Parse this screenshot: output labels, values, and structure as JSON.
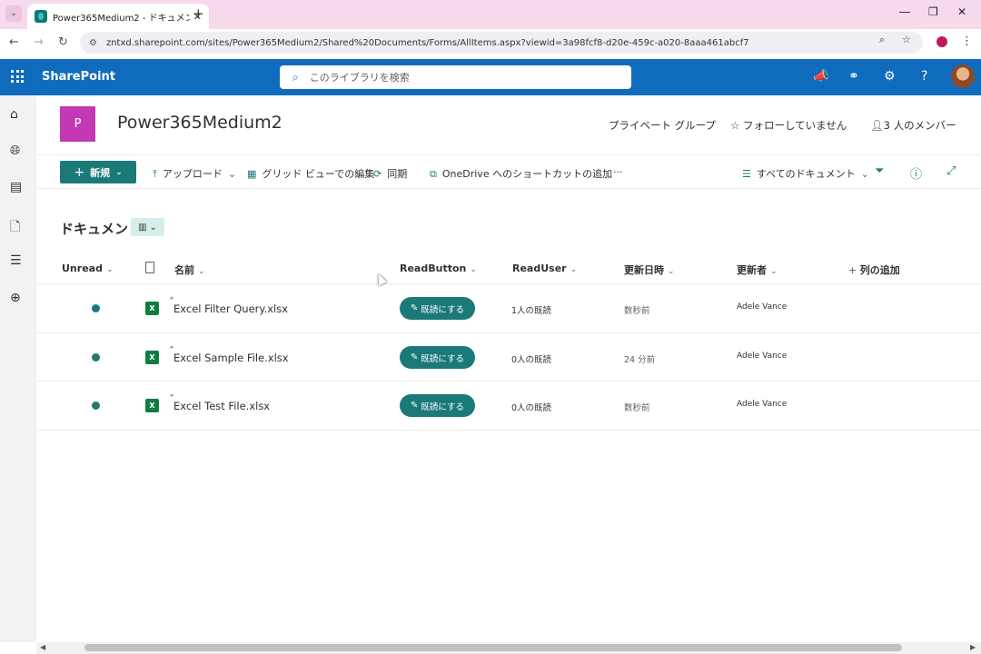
{
  "browser": {
    "tab_title": "Power365Medium2 - ドキュメント",
    "tab_close": "✕",
    "new_tab": "+",
    "url": "zntxd.sharepoint.com/sites/Power365Medium2/Shared%20Documents/Forms/AllItems.aspx?viewid=3a98fcf8-d20e-459c-a020-8aaa461abcf7"
  },
  "suitebar": {
    "brand": "SharePoint",
    "search_placeholder": "このライブラリを検索"
  },
  "site": {
    "logo_letter": "P",
    "title": "Power365Medium2",
    "privacy": "プライベート グループ",
    "follow": "フォローしていません",
    "members": "3 人のメンバー"
  },
  "commandbar": {
    "new": "新規",
    "upload": "アップロード",
    "grid_edit": "グリッド ビューでの編集",
    "sync": "同期",
    "onedrive_shortcut": "OneDrive へのショートカットの追加",
    "more": "···",
    "view": "すべてのドキュメント"
  },
  "list": {
    "title": "ドキュメント",
    "columns": {
      "unread": "Unread",
      "name": "名前",
      "read_button": "ReadButton",
      "read_user": "ReadUser",
      "modified": "更新日時",
      "modified_by": "更新者",
      "add_column": "列の追加"
    },
    "rows": [
      {
        "name": "Excel Filter Query.xlsx",
        "button": "既読にする",
        "read_user": "1人の既読",
        "modified": "数秒前",
        "modified_by": "Adele Vance"
      },
      {
        "name": "Excel Sample File.xlsx",
        "button": "既読にする",
        "read_user": "0人の既読",
        "modified": "24 分前",
        "modified_by": "Adele Vance"
      },
      {
        "name": "Excel Test File.xlsx",
        "button": "既読にする",
        "read_user": "0人の既読",
        "modified": "数秒前",
        "modified_by": "Adele Vance"
      }
    ]
  },
  "colors": {
    "suitebar": "#0f6cbd",
    "accent": "#1b7a78",
    "site_logo": "#c239b3",
    "excel": "#107c41"
  }
}
